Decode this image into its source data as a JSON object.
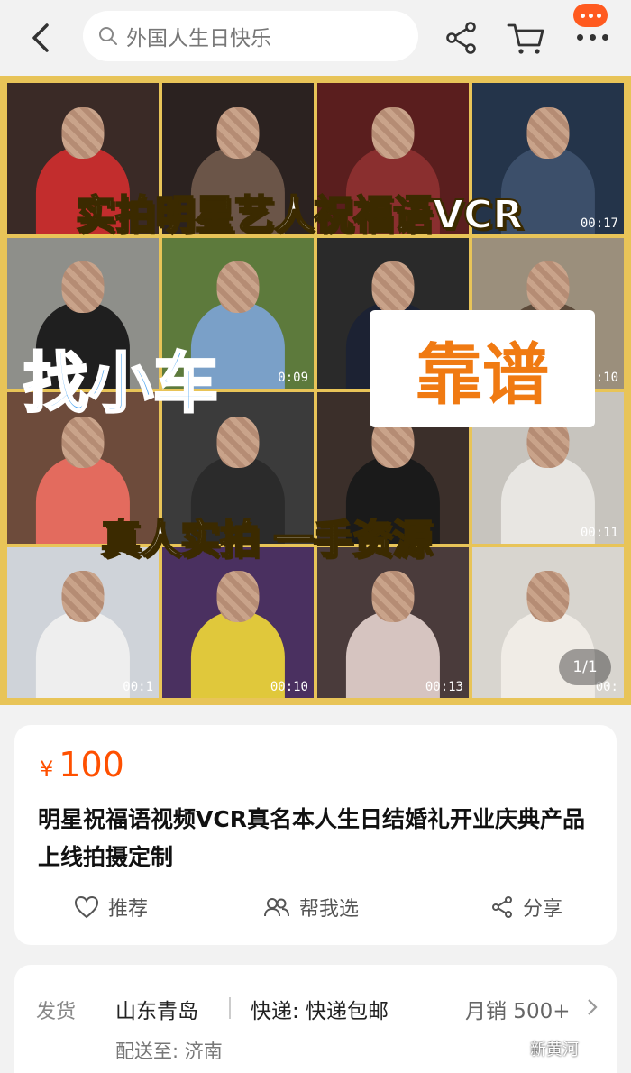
{
  "header": {
    "search_placeholder": "外国人生日快乐"
  },
  "product_image": {
    "banner_top": "实拍明星艺人祝福语VCR",
    "tag_left": "找小车",
    "tag_right": "靠谱",
    "banner_bottom": "真人实拍  一手资源",
    "page_indicator": "1/1",
    "video_times": [
      "",
      "",
      "",
      "00:17",
      "",
      "0:09",
      "",
      "0:10",
      "",
      "",
      "",
      "00:11",
      "00:1",
      "00:10",
      "00:13",
      "00:"
    ]
  },
  "product": {
    "currency": "¥",
    "price": "100",
    "title": "明星祝福语视频VCR真名本人生日结婚礼开业庆典产品上线拍摄定制",
    "actions": {
      "recommend": "推荐",
      "help_choose": "帮我选",
      "share": "分享"
    }
  },
  "shipping": {
    "label": "发货",
    "origin": "山东青岛",
    "express": "快递: 快递包邮",
    "monthly_sales": "月销 500+",
    "deliver_to": "配送至: 济南"
  },
  "watermark": "新黄河",
  "colors": {
    "accent": "#ff5000",
    "frame": "#e8c458",
    "tag_blue": "#4aa3f0",
    "tag_orange": "#f07a12"
  }
}
